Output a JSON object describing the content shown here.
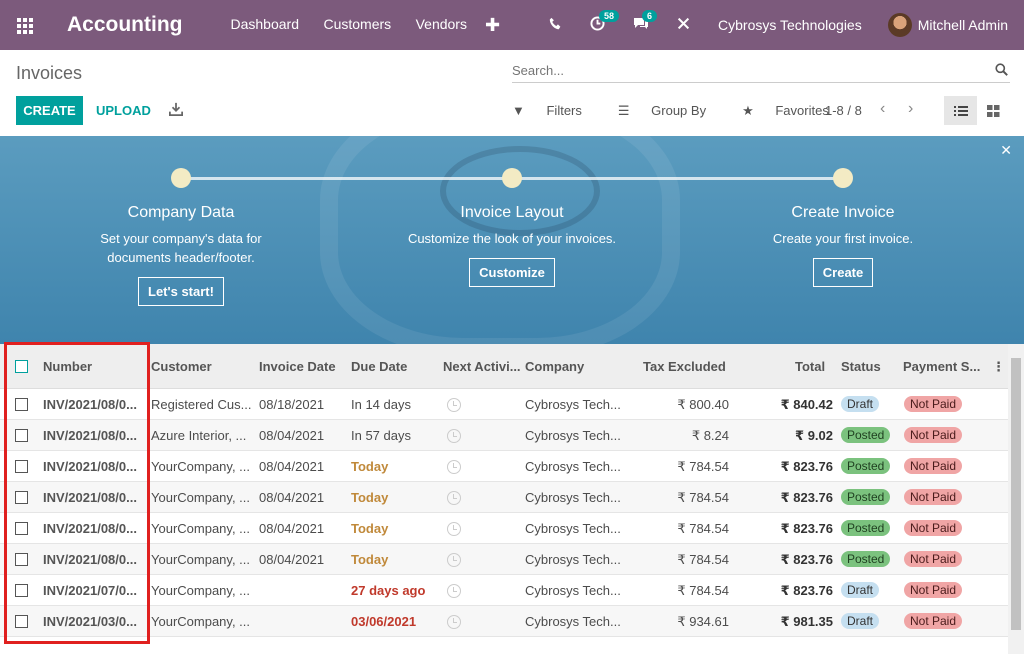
{
  "nav": {
    "brand": "Accounting",
    "menu": [
      "Dashboard",
      "Customers",
      "Vendors"
    ],
    "plus": "✚",
    "activity_count": "58",
    "message_count": "6",
    "company": "Cybrosys Technologies",
    "user": "Mitchell Admin"
  },
  "page": {
    "title": "Invoices",
    "search_placeholder": "Search...",
    "create": "CREATE",
    "upload": "UPLOAD",
    "filters": "Filters",
    "group_by": "Group By",
    "favorites": "Favorites",
    "pager": "1-8 / 8"
  },
  "banner": {
    "steps": [
      {
        "title": "Company Data",
        "text": "Set your company's data for documents header/footer.",
        "button": "Let's start!"
      },
      {
        "title": "Invoice Layout",
        "text": "Customize the look of your invoices.",
        "button": "Customize"
      },
      {
        "title": "Create Invoice",
        "text": "Create your first invoice.",
        "button": "Create"
      }
    ]
  },
  "table": {
    "columns": [
      "Number",
      "Customer",
      "Invoice Date",
      "Due Date",
      "Next Activi...",
      "Company",
      "Tax Excluded",
      "Total",
      "Status",
      "Payment S..."
    ],
    "rows": [
      {
        "number": "INV/2021/08/0...",
        "customer": "Registered Cus...",
        "invoice_date": "08/18/2021",
        "due": "In 14 days",
        "due_kind": "normal",
        "company": "Cybrosys Tech...",
        "tax_excl": "₹ 800.40",
        "total": "₹ 840.42",
        "status": "Draft",
        "payment": "Not Paid"
      },
      {
        "number": "INV/2021/08/0...",
        "customer": "Azure Interior, ...",
        "invoice_date": "08/04/2021",
        "due": "In 57 days",
        "due_kind": "normal",
        "company": "Cybrosys Tech...",
        "tax_excl": "₹ 8.24",
        "total": "₹ 9.02",
        "status": "Posted",
        "payment": "Not Paid"
      },
      {
        "number": "INV/2021/08/0...",
        "customer": "YourCompany, ...",
        "invoice_date": "08/04/2021",
        "due": "Today",
        "due_kind": "today",
        "company": "Cybrosys Tech...",
        "tax_excl": "₹ 784.54",
        "total": "₹ 823.76",
        "status": "Posted",
        "payment": "Not Paid"
      },
      {
        "number": "INV/2021/08/0...",
        "customer": "YourCompany, ...",
        "invoice_date": "08/04/2021",
        "due": "Today",
        "due_kind": "today",
        "company": "Cybrosys Tech...",
        "tax_excl": "₹ 784.54",
        "total": "₹ 823.76",
        "status": "Posted",
        "payment": "Not Paid"
      },
      {
        "number": "INV/2021/08/0...",
        "customer": "YourCompany, ...",
        "invoice_date": "08/04/2021",
        "due": "Today",
        "due_kind": "today",
        "company": "Cybrosys Tech...",
        "tax_excl": "₹ 784.54",
        "total": "₹ 823.76",
        "status": "Posted",
        "payment": "Not Paid"
      },
      {
        "number": "INV/2021/08/0...",
        "customer": "YourCompany, ...",
        "invoice_date": "08/04/2021",
        "due": "Today",
        "due_kind": "today",
        "company": "Cybrosys Tech...",
        "tax_excl": "₹ 784.54",
        "total": "₹ 823.76",
        "status": "Posted",
        "payment": "Not Paid"
      },
      {
        "number": "INV/2021/07/0...",
        "customer": "YourCompany, ...",
        "invoice_date": "",
        "due": "27 days ago",
        "due_kind": "overdue",
        "company": "Cybrosys Tech...",
        "tax_excl": "₹ 784.54",
        "total": "₹ 823.76",
        "status": "Draft",
        "payment": "Not Paid"
      },
      {
        "number": "INV/2021/03/0...",
        "customer": "YourCompany, ...",
        "invoice_date": "",
        "due": "03/06/2021",
        "due_kind": "overdue",
        "company": "Cybrosys Tech...",
        "tax_excl": "₹ 934.61",
        "total": "₹ 981.35",
        "status": "Draft",
        "payment": "Not Paid"
      }
    ]
  },
  "colors": {
    "brand": "#7c5a7c",
    "accent": "#00a09d",
    "highlight": "#e0201f"
  }
}
